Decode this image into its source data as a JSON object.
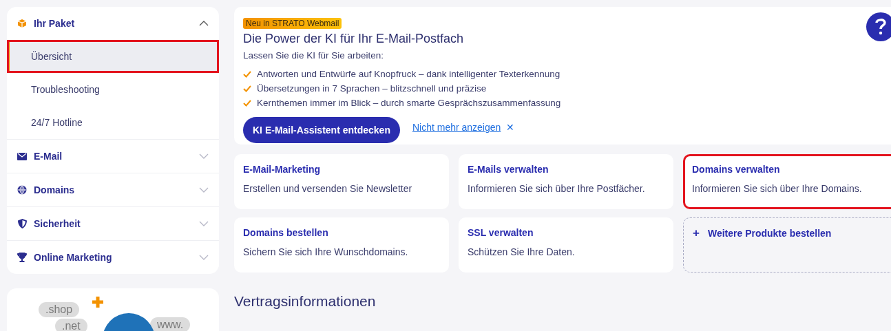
{
  "sidebar": {
    "sections": [
      {
        "label": "Ihr Paket",
        "kind": "box",
        "expanded": true,
        "items": [
          {
            "label": "Übersicht",
            "selected": true,
            "highlighted": true
          },
          {
            "label": "Troubleshooting",
            "selected": false,
            "highlighted": false
          },
          {
            "label": "24/7 Hotline",
            "selected": false,
            "highlighted": false
          }
        ]
      },
      {
        "label": "E-Mail",
        "kind": "mail",
        "expanded": false
      },
      {
        "label": "Domains",
        "kind": "globe",
        "expanded": false
      },
      {
        "label": "Sicherheit",
        "kind": "shield",
        "expanded": false
      },
      {
        "label": "Online Marketing",
        "kind": "trophy",
        "expanded": false
      }
    ],
    "promo_image": {
      "labels": [
        ".shop",
        ".net",
        "www."
      ]
    }
  },
  "promo": {
    "badge": "Neu in STRATO Webmail",
    "title": "Die Power der KI für Ihr E-Mail-Postfach",
    "intro": "Lassen Sie die KI für Sie arbeiten:",
    "features": [
      "Antworten und Entwürfe auf Knopfruck – dank intelligenter Texterkennung",
      "Übersetzungen in 7 Sprachen – blitzschnell und präzise",
      "Kernthemen immer im Blick – durch smarte Gesprächszusammenfassung"
    ],
    "button": "KI E-Mail-Assistent entdecken",
    "dismiss": "Nicht mehr anzeigen",
    "dismiss_icon": "✕"
  },
  "tiles": [
    {
      "kind": "card",
      "title": "E-Mail-Marketing",
      "text": "Erstellen und versenden Sie Newsletter",
      "highlighted": false
    },
    {
      "kind": "card",
      "title": "E-Mails verwalten",
      "text": "Informieren Sie sich über Ihre Postfächer.",
      "highlighted": false
    },
    {
      "kind": "card",
      "title": "Domains verwalten",
      "text": "Informieren Sie sich über Ihre Domains.",
      "highlighted": true
    },
    {
      "kind": "card",
      "title": "Domains bestellen",
      "text": "Sichern Sie sich Ihre Wunschdomains.",
      "highlighted": false
    },
    {
      "kind": "card",
      "title": "SSL verwalten",
      "text": "Schützen Sie Ihre Daten.",
      "highlighted": false
    },
    {
      "kind": "add",
      "title": "Weitere Produkte bestellen",
      "icon": "+",
      "highlighted": false
    }
  ],
  "section_heading": "Vertragsinformationen"
}
